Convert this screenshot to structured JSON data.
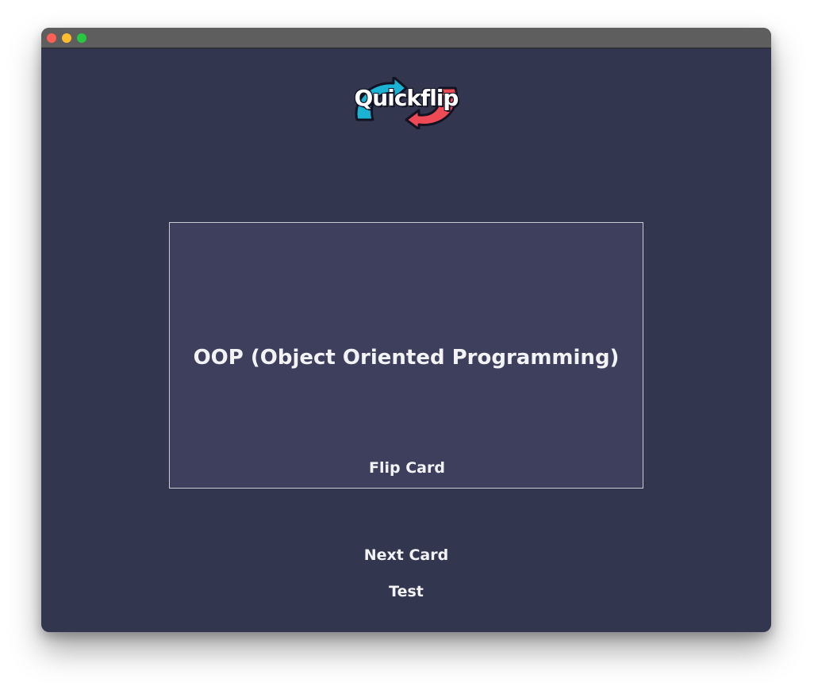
{
  "app": {
    "title": "Quickflip"
  },
  "window": {
    "traffic_lights": {
      "close_color": "#ff5f57",
      "minimize_color": "#febc2e",
      "zoom_color": "#28c840"
    },
    "background_color": "#33364f"
  },
  "logo": {
    "text": "Quickflip",
    "colors": {
      "blue_arrow": "#1ab3d4",
      "red_arrow": "#ee4a55",
      "outline": "#111322"
    }
  },
  "card": {
    "term": "OOP (Object Oriented Programming)",
    "flip_label": "Flip Card",
    "background_color": "#3d3f5c",
    "border_color": "#c9cad6"
  },
  "actions": {
    "next_label": "Next Card",
    "test_label": "Test"
  }
}
